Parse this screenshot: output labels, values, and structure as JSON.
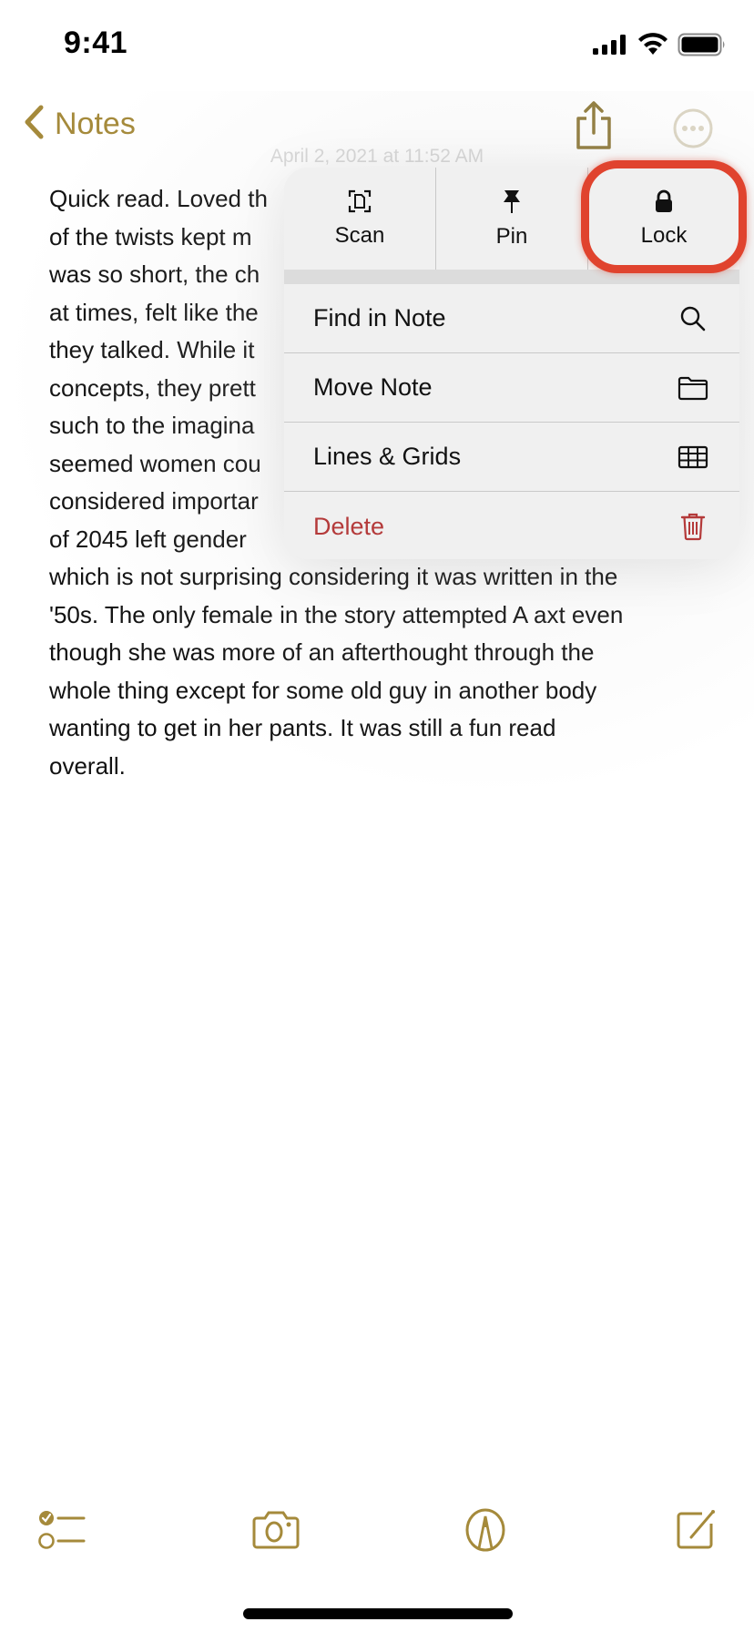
{
  "status_bar": {
    "time": "9:41",
    "signal_icon": "cellular-signal-icon",
    "wifi_icon": "wifi-icon",
    "battery_icon": "battery-full-icon"
  },
  "nav": {
    "back_label": "Notes",
    "back_icon": "chevron-left-icon",
    "share_icon": "share-icon",
    "more_icon": "ellipsis-circle-icon",
    "accent_color": "#a58a3b"
  },
  "note": {
    "date": "April 2, 2021 at 11:52 AM",
    "lines": [
      "Quick read. Loved th",
      "of the twists kept m",
      "was so short, the ch",
      "at times, felt like the",
      "they talked. While it",
      "concepts, they prett",
      "such to the imagina",
      "seemed women cou",
      "considered importar",
      "of 2045 left gender",
      "which is not surprising considering it was written in the",
      "'50s. The only female in the story attempted A axt even",
      "though she was more of an afterthought through the",
      "whole thing except for some old guy in another body",
      "wanting to get in her pants. It was still a fun read",
      "overall."
    ]
  },
  "context_menu": {
    "actions": [
      {
        "label": "Scan",
        "icon": "document-scan-icon"
      },
      {
        "label": "Pin",
        "icon": "pin-icon"
      },
      {
        "label": "Lock",
        "icon": "lock-icon"
      }
    ],
    "items": [
      {
        "label": "Find in Note",
        "icon": "search-icon",
        "destructive": false
      },
      {
        "label": "Move Note",
        "icon": "folder-icon",
        "destructive": false
      },
      {
        "label": "Lines & Grids",
        "icon": "grid-icon",
        "destructive": false
      },
      {
        "label": "Delete",
        "icon": "trash-icon",
        "destructive": true
      }
    ],
    "highlighted_action": "Lock",
    "highlight_color": "#e0432e",
    "destructive_color": "#b43a3a"
  },
  "toolbar": {
    "items": [
      {
        "name": "checklist",
        "icon": "checklist-icon"
      },
      {
        "name": "camera",
        "icon": "camera-icon"
      },
      {
        "name": "markup",
        "icon": "markup-pen-icon"
      },
      {
        "name": "compose",
        "icon": "compose-icon"
      }
    ]
  }
}
